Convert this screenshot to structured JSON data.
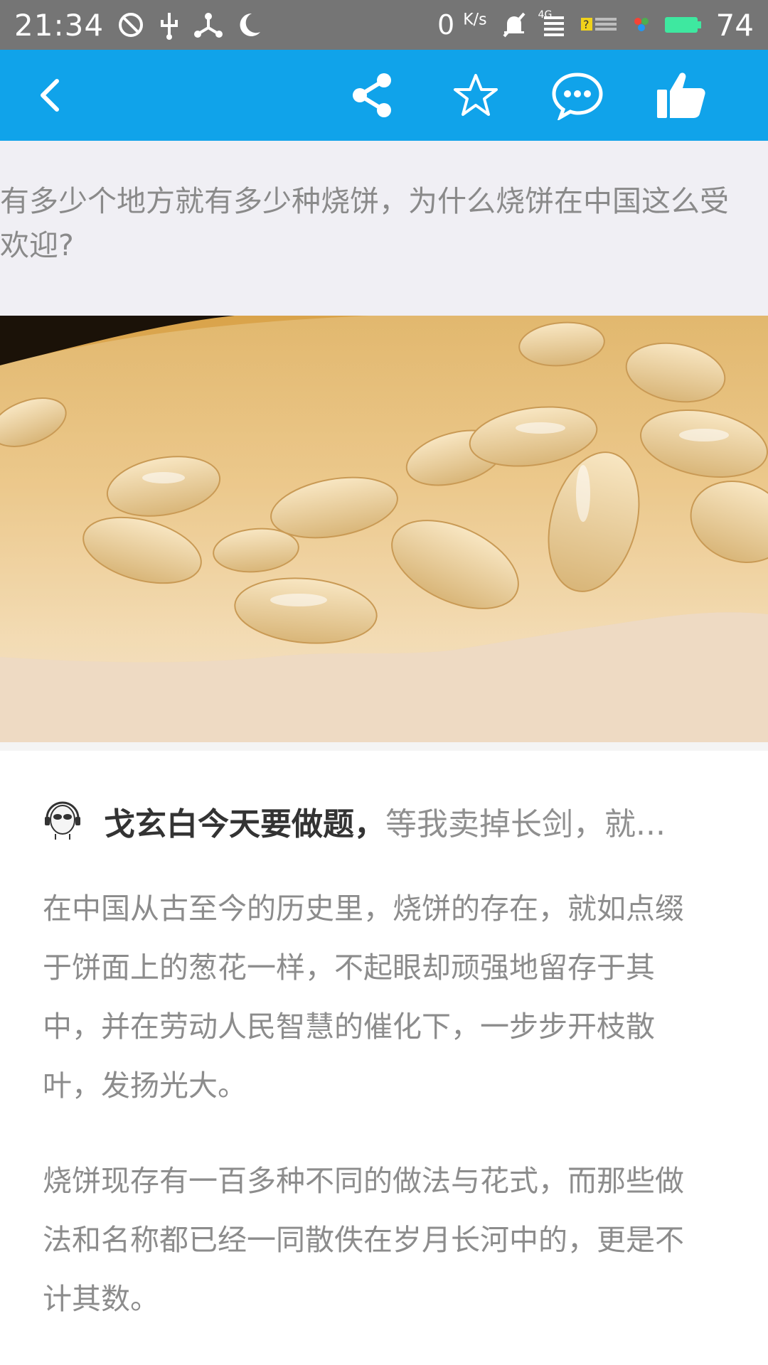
{
  "status_bar": {
    "time": "21:34",
    "net_speed": "0",
    "net_speed_unit": "K/s",
    "network_label": "4G",
    "battery": "74",
    "icons": [
      "do-not-disturb-icon",
      "usb-icon",
      "tether-icon",
      "moon-icon",
      "notification-mute-icon",
      "signal-icon",
      "sim-icon",
      "battery-icon"
    ]
  },
  "toolbar": {
    "background": "#10a3ea",
    "icons": [
      "back-icon",
      "share-icon",
      "star-icon",
      "comment-icon",
      "like-icon"
    ]
  },
  "question": {
    "title": "有多少个地方就有多少种烧饼，为什么烧饼在中国这么受欢迎?"
  },
  "answer": {
    "author_name": "戈玄白今天要做题，",
    "author_bio": "等我卖掉长剑，就...",
    "paragraphs": [
      "在中国从古至今的历史里，烧饼的存在，就如点缀于饼面上的葱花一样，不起眼却顽强地留存于其中，并在劳动人民智慧的催化下，一步步开枝散叶，发扬光大。",
      "烧饼现存有一百多种不同的做法与花式，而那些做法和名称都已经一同散佚在岁月长河中的，更是不计其数。"
    ]
  }
}
